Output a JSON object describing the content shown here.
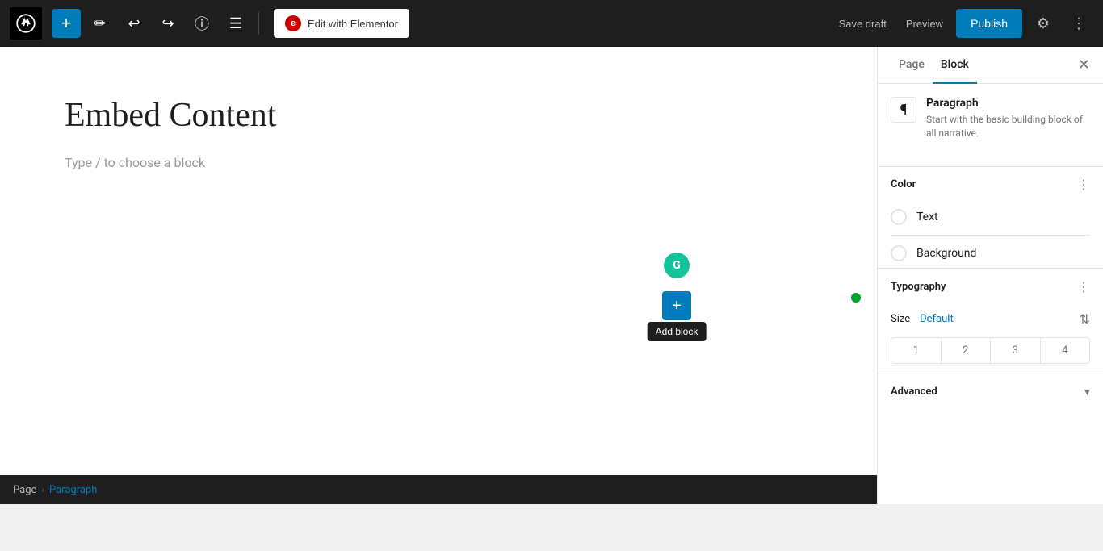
{
  "topbar": {
    "add_label": "+",
    "edit_with_elementor": "Edit with Elementor",
    "elementor_icon": "e",
    "save_draft": "Save draft",
    "preview": "Preview",
    "publish": "Publish"
  },
  "editor": {
    "post_title": "Embed Content",
    "placeholder": "Type / to choose a block",
    "add_block_tooltip": "Add block",
    "grammarly_letter": "G"
  },
  "sidebar": {
    "tab_page": "Page",
    "tab_block": "Block",
    "paragraph_icon": "¶",
    "block_type": "Paragraph",
    "block_description_pre": "Start with the basic building block of",
    "block_description_post": "all narrative.",
    "block_description_link": "",
    "color_section_title": "Color",
    "text_label": "Text",
    "background_label": "Background",
    "typography_title": "Typography",
    "size_label": "Size",
    "size_default": "Default",
    "size_1": "1",
    "size_2": "2",
    "size_3": "3",
    "size_4": "4",
    "advanced_title": "Advanced"
  },
  "breadcrumb": {
    "page": "Page",
    "separator": "›",
    "current": "Paragraph"
  }
}
